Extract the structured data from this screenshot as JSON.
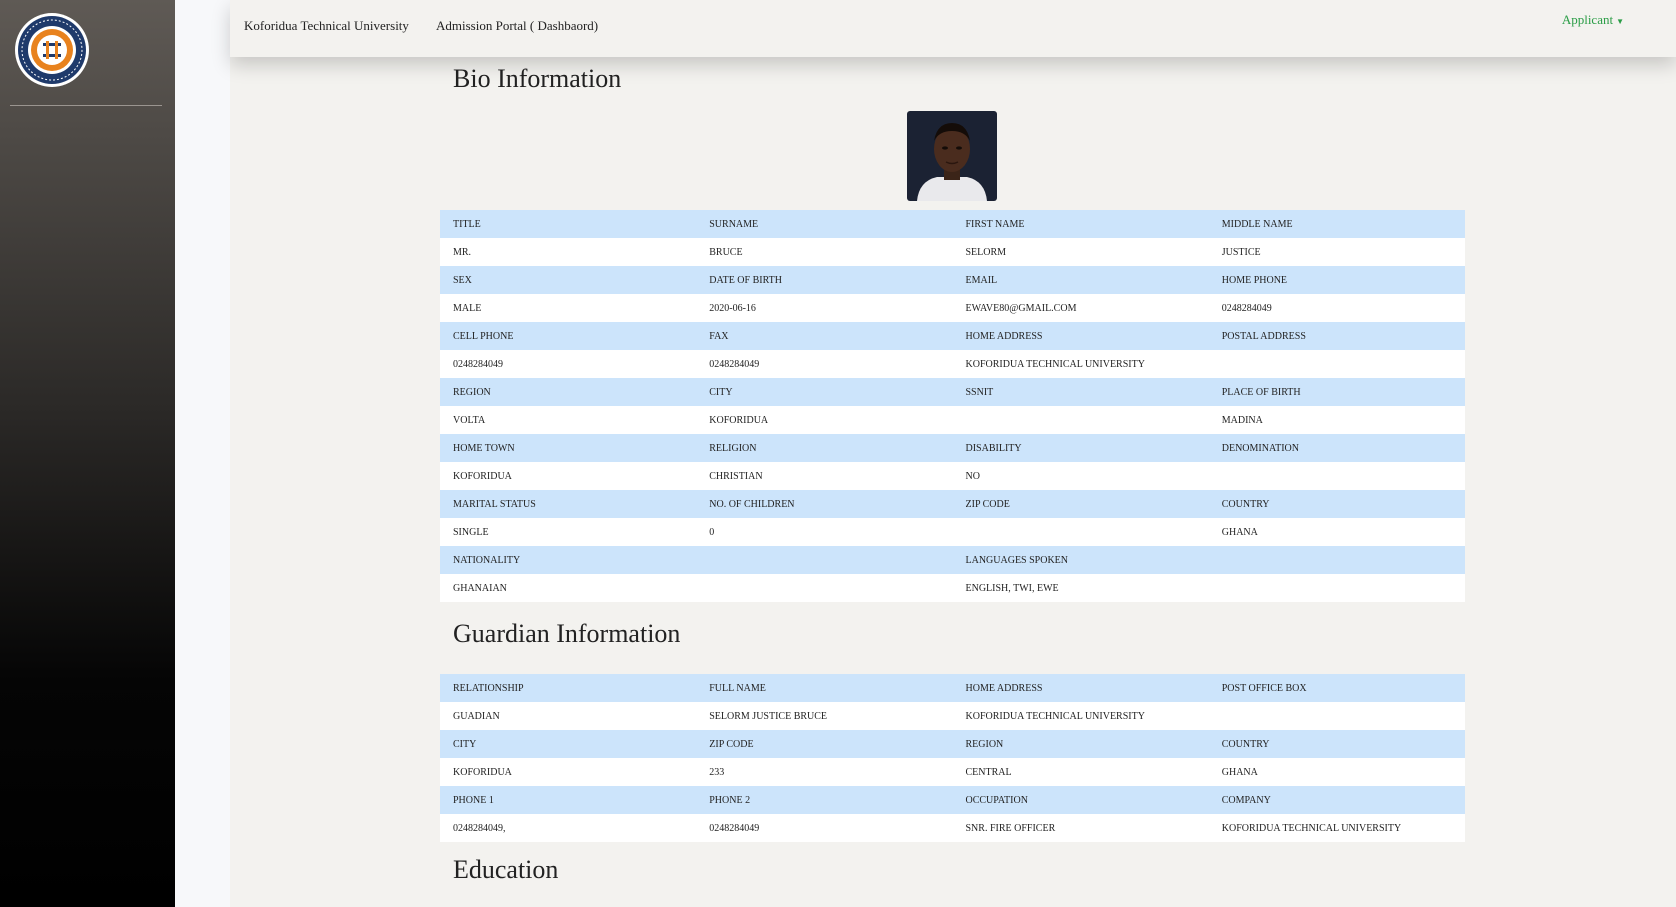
{
  "header": {
    "brand": "Koforidua Technical University",
    "portal": "Admission Portal ( Dashbaord)",
    "user_menu": "Applicant"
  },
  "sections": {
    "bio_title": "Bio Information",
    "guardian_title": "Guardian Information",
    "education_title": "Education"
  },
  "bio": {
    "rows": [
      [
        "TITLE",
        "SURNAME",
        "FIRST NAME",
        "MIDDLE NAME"
      ],
      [
        "MR.",
        "BRUCE",
        "SELORM",
        "JUSTICE"
      ],
      [
        "SEX",
        "DATE OF BIRTH",
        "EMAIL",
        "HOME PHONE"
      ],
      [
        "MALE",
        "2020-06-16",
        "EWAVE80@GMAIL.COM",
        "0248284049"
      ],
      [
        "CELL PHONE",
        "FAX",
        "HOME ADDRESS",
        "POSTAL ADDRESS"
      ],
      [
        "0248284049",
        "0248284049",
        "KOFORIDUA TECHNICAL UNIVERSITY",
        ""
      ],
      [
        "REGION",
        "CITY",
        "SSNIT",
        "PLACE OF BIRTH"
      ],
      [
        "VOLTA",
        "KOFORIDUA",
        "",
        "MADINA"
      ],
      [
        "HOME TOWN",
        "RELIGION",
        "DISABILITY",
        "DENOMINATION"
      ],
      [
        "KOFORIDUA",
        "CHRISTIAN",
        "NO",
        ""
      ],
      [
        "MARITAL STATUS",
        "NO. OF CHILDREN",
        "ZIP CODE",
        "COUNTRY"
      ],
      [
        "SINGLE",
        "0",
        "",
        "GHANA"
      ],
      [
        "NATIONALITY",
        "",
        "LANGUAGES SPOKEN",
        ""
      ],
      [
        "GHANAIAN",
        "",
        "ENGLISH, TWI, EWE",
        ""
      ]
    ]
  },
  "guardian": {
    "rows": [
      [
        "RELATIONSHIP",
        "FULL NAME",
        "HOME ADDRESS",
        "POST OFFICE BOX"
      ],
      [
        "GUADIAN",
        "SELORM JUSTICE BRUCE",
        "KOFORIDUA TECHNICAL UNIVERSITY",
        ""
      ],
      [
        "CITY",
        "ZIP CODE",
        "REGION",
        "COUNTRY"
      ],
      [
        "KOFORIDUA",
        "233",
        "CENTRAL",
        "GHANA"
      ],
      [
        "PHONE 1",
        "PHONE 2",
        "OCCUPATION",
        "COMPANY"
      ],
      [
        "0248284049,",
        "0248284049",
        "SNR. FIRE OFFICER",
        "KOFORIDUA TECHNICAL UNIVERSITY"
      ]
    ]
  },
  "colors": {
    "header_row": "#cce4fb",
    "value_row": "#ffffff",
    "accent_green": "#2a9d46"
  }
}
